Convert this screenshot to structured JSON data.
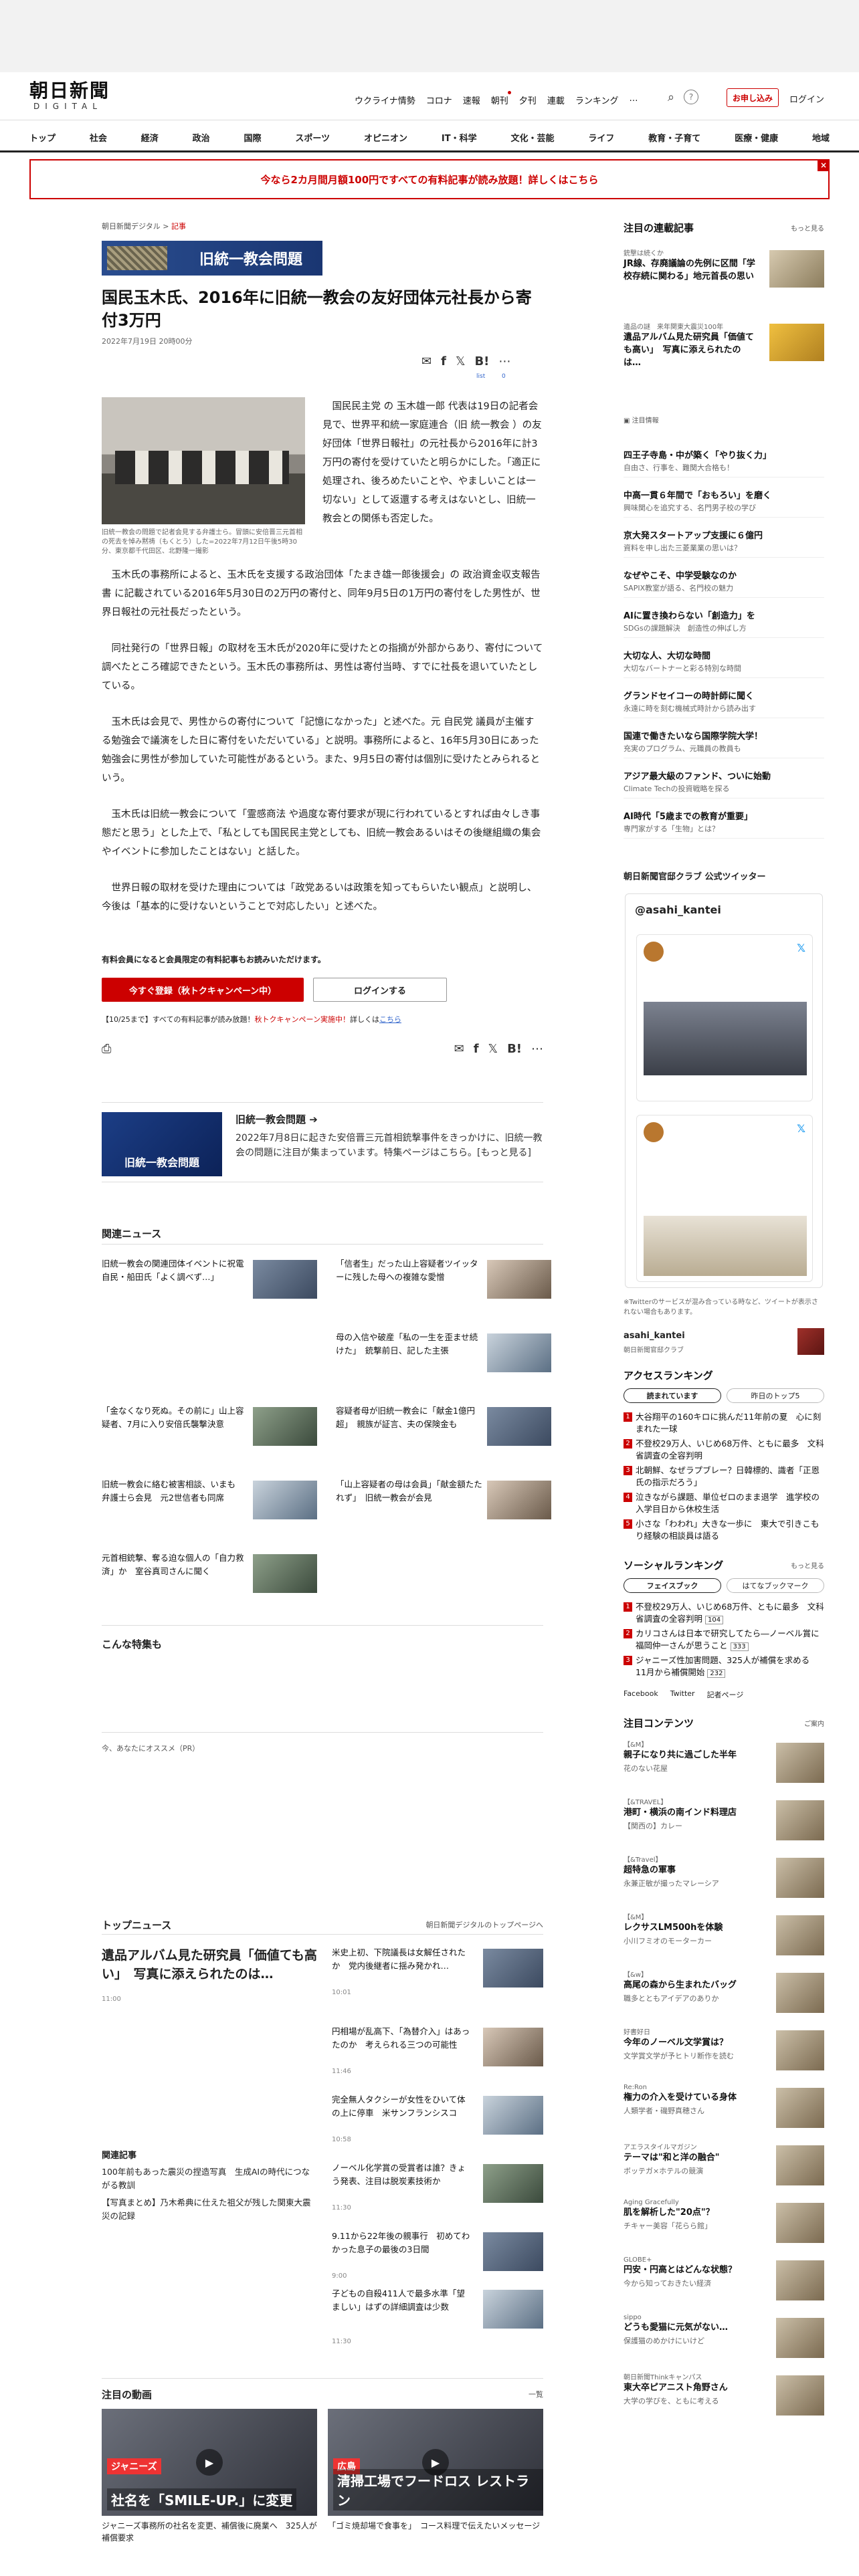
{
  "header": {
    "logo_title": "朝日新聞",
    "logo_sub": "DIGITAL",
    "nav": [
      "ウクライナ情勢",
      "コロナ",
      "速報",
      "朝刊",
      "夕刊",
      "連載",
      "ランキング",
      "…"
    ],
    "subscribe_label": "お申し込み",
    "login_label": "ログイン"
  },
  "global_nav": [
    "トップ",
    "社会",
    "経済",
    "政治",
    "国際",
    "スポーツ",
    "オピニオン",
    "IT・科学",
    "文化・芸能",
    "ライフ",
    "教育・子育て",
    "医療・健康",
    "地域"
  ],
  "banner": {
    "text": "今なら2カ月間月額100円ですべての有料記事が読み放題！詳しくはこちら",
    "close": "×"
  },
  "article": {
    "crumb_site": "朝日新聞デジタル",
    "crumb_sep": ">",
    "crumb_section": "記事",
    "tag_banner": "旧統一教会問題",
    "title": "国民玉木氏、2016年に旧統一教会の友好団体元社長から寄付3万円",
    "date": "2022年7月19日 20時00分",
    "share_list": "list",
    "share_count": "0",
    "photo_caption": "旧統一教会の問題で記者会見する弁護士ら。冒頭に安倍晋三元首相の死去を悼み黙祷（もくとう）した=2022年7月12日午後5時30分、東京都千代田区、北野隆一撮影",
    "lead": "国民民主党 の 玉木雄一郎 代表は19日の記者会見で、世界平和統一家庭連合（旧 統一教会 ）の友好団体「世界日報社」の元社長から2016年に計3万円の寄付を受けていたと明らかにした。「適正に処理され、後ろめたいことや、やましいことは一切ない」として返還する考えはないとし、旧統一教会との関係も否定した。",
    "paragraphs": [
      "玉木氏の事務所によると、玉木氏を支援する政治団体「たまき雄一郎後援会」の 政治資金収支報告書 に記載されている2016年5月30日の2万円の寄付と、同年9月5日の1万円の寄付をした男性が、世界日報社の元社長だったという。",
      "同社発行の「世界日報」の取材を玉木氏が2020年に受けたとの指摘が外部からあり、寄付について調べたところ確認できたという。玉木氏の事務所は、男性は寄付当時、すでに社長を退いていたとしている。",
      "玉木氏は会見で、男性からの寄付について「記憶になかった」と述べた。元 自民党 議員が主催する勉強会で議演をした日に寄付をいただいている」と説明。事務所によると、16年5月30日にあった勉強会に男性が参加していた可能性があるという。また、9月5日の寄付は個別に受けたとみられるという。",
      "玉木氏は旧統一教会について「霊感商法 や過度な寄付要求が現に行われているとすれば由々しき事態だと思う」とした上で、「私としても国民民主党としても、旧統一教会あるいはその後継組織の集会やイベントに参加したことはない」と話した。",
      "世界日報の取材を受けた理由については「政党あるいは政策を知ってもらいたい観点」と説明し、今後は「基本的に受けないということで対応したい」と述べた。"
    ],
    "member_note": "有料会員になると会員限定の有料記事もお読みいただけます。",
    "register_button": "今すぐ登録（秋トクキャンペーン中）",
    "login_button": "ログインする",
    "promo_prefix": "【10/25まで】すべての有料記事が読み放題！",
    "promo_highlight": "秋トクキャンペーン実施中！",
    "promo_suffix": "詳しくは",
    "promo_link": "こちら"
  },
  "feature": {
    "image_label": "旧統一教会問題",
    "heading": "旧統一教会問題 ➔",
    "desc": "2022年7月8日に起きた安倍晋三元首相銃撃事件をきっかけに、旧統一教会の問題に注目が集まっています。特集ページはこちら。[もっと見る]"
  },
  "related": {
    "heading": "関連ニュース",
    "items": [
      "旧統一教会の関連団体イベントに祝電　自民・船田氏「よく調べず…」",
      "「信者生」だった山上容疑者ツイッターに残した母への複雑な愛憎",
      "母の入信や破産「私の一生を歪ませ続けた」　銃撃前日、記した主張",
      "「金なくなり死ぬ。その前に」山上容疑者、7月に入り安倍氏襲撃決意",
      "容疑者母が旧統一教会に「献金1億円超」　親族が証言、夫の保険金も",
      "旧統一教会に絡む被害相談、いまも　弁護士ら会見　元2世信者も同席",
      "「山上容疑者の母は会員」「献金額たたれず」　旧統一教会が会見",
      "元首相銃撃、奪る迫な個人の「自力救済」か　室谷真司さんに聞く"
    ]
  },
  "special": {
    "heading": "こんな特集も"
  },
  "recommend": {
    "heading": "今、あなたにオススメ（PR）"
  },
  "top_news": {
    "heading": "トップニュース",
    "link": "朝日新聞デジタルのトップページへ",
    "main_title": "遺品アルバム見た研究員「価値ても高い」　写真に添えられたのは…",
    "main_time": "11:00",
    "related_heading": "関連記事",
    "related_items": [
      "100年前もあった震災の捏造写真　生成AIの時代につながる教訓",
      "【写真まとめ】乃木希典に仕えた祖父が残した関東大震災の記録"
    ],
    "items": [
      {
        "t": "米史上初、下院議長は女解任されたか　党内後継者に揺み発かれ…",
        "time": "10:01"
      },
      {
        "t": "円相場が乱高下、「為替介入」はあったのか　考えられる三つの可能性",
        "time": "11:46"
      },
      {
        "t": "完全無人タクシーが女性をひいて体の上に停車　米サンフランシスコ",
        "time": "10:58"
      },
      {
        "t": "ノーベル化学賞の受賞者は誰？きょう発表、注目は脱炭素技術か",
        "time": "11:30"
      },
      {
        "t": "9.11から22年後の親事行　初めてわかった息子の最後の3日間",
        "time": "9:00"
      },
      {
        "t": "子どもの自殺411人で最多水準「望ましい」はずの詳細調査は少数",
        "time": "11:30"
      }
    ]
  },
  "video": {
    "heading": "注目の動画",
    "link": "一覧",
    "items": [
      {
        "tag": "ジャニーズ",
        "label": "社名を「SMILE-UP.」に変更",
        "cap": "ジャニーズ事務所の社名を変更、補償後に廃業へ　325人が補償要求"
      },
      {
        "tag": "広島",
        "label": "清掃工場でフードロス レストラン",
        "cap": "「ゴミ焼却場で食事を」　コース料理で伝えたいメッセージ"
      }
    ]
  },
  "sidebar": {
    "series_heading": "注目の連載記事",
    "more": "もっと見る",
    "series": [
      {
        "cat": "銃撃は続くか",
        "t": "JR線、存廃議論の先例に区間「学校存続に関わる」地元首長の思い"
      },
      {
        "cat": "遺品の謎　来年関東大震災100年",
        "t": "遺品アルバム見た研究員「価値ても高い」　写真に添えられたのは…"
      }
    ],
    "kw_heading": "注目情報",
    "keywords": [
      {
        "a": "四王子寺島・中が築く「やり抜く力」",
        "b": "自由さ、行事を、難関大合格も！"
      },
      {
        "a": "中高一貫６年間で「おもろい」を磨く",
        "b": "興味関心を追究する、名門男子校の学び"
      },
      {
        "a": "京大発スタートアップ支援に６億円",
        "b": "資料を申し出た三菱業業の思いは？"
      },
      {
        "a": "なぜやこそ、中学受験なのか",
        "b": "SAPIX教室が語る、名門校の魅力"
      },
      {
        "a": "AIに置き換わらない「創造力」を",
        "b": "SDGsの課題解決　創造性の伸ばし方"
      },
      {
        "a": "大切な人、大切な時間",
        "b": "大切なバートナーと彩る特別な時間"
      },
      {
        "a": "グランドセイコーの時計師に聞く",
        "b": "永遠に時を刻む機械式時計から読み出す"
      },
      {
        "a": "国連で働きたいなら国際学院大学！",
        "b": "充実のプログラム、元職員の教員も"
      },
      {
        "a": "アジア最大級のファンド、ついに始動",
        "b": "Climate Techの投資戦略を探る"
      },
      {
        "a": "AI時代「5歳までの教育が重要」",
        "b": "専門家がする「生物」とは？"
      }
    ],
    "twitter_heading": "朝日新聞官邸クラブ 公式ツイッター",
    "tw_handle": "@asahi_kantei",
    "tw_note": "※Twitterのサービスが混み合っている時など、ツイートが表示されない場合もあります。",
    "tw_account": "asahi_kantei",
    "tw_account_sub": "朝日新聞官邸クラブ",
    "access_heading": "アクセスランキング",
    "access_tabs": [
      "読まれています",
      "昨日のトップ5"
    ],
    "access": [
      "大谷翔平の160キロに挑んだ11年前の夏　心に刻まれた一球",
      "不登校29万人、いじめ68万件、ともに最多　文科省調査の全容判明",
      "北朝鮮、なぜラプブレー？日韓標的、識者「正恩氏の指示だろう」",
      "泣きながら課題、単位ゼロのまま退学　進学校の入学目日から休校生活",
      "小さな「わわれ」大きな一歩に　東大で引きこもり経験の相談員は語る"
    ],
    "social_heading": "ソーシャルランキング",
    "social_tabs": [
      "フェイスブック",
      "はてなブックマーク"
    ],
    "social": [
      {
        "t": "不登校29万人、いじめ68万件、ともに最多　文科省調査の全容判明",
        "c": "104"
      },
      {
        "t": "カリコさんは日本で研究してたら―ノーベル賞に福岡仲一さんが思うこと",
        "c": "333"
      },
      {
        "t": "ジャニーズ性加害問題、325人が補償を求める　11月から補償開始",
        "c": "232"
      }
    ],
    "follow": [
      "Facebook",
      "Twitter",
      "記者ページ"
    ],
    "contents_heading": "注目コンテンツ",
    "contents_link": "ご案内",
    "contents": [
      {
        "c": "【&M】",
        "a": "親子になり共に過ごした半年",
        "b": "花のない花屋"
      },
      {
        "c": "【&TRAVEL】",
        "a": "港町・横浜の南インド料理店",
        "b": "【関西の】カレー"
      },
      {
        "c": "【&Travel】",
        "a": "超特急の軍事",
        "b": "永兼正敏が撮ったマレーシア"
      },
      {
        "c": "【&M】",
        "a": "レクサスLM500hを体験",
        "b": "小川フミオのモーターカー"
      },
      {
        "c": "【&w】",
        "a": "高尾の森から生まれたバッグ",
        "b": "職多とともアイデアのありか"
      },
      {
        "c": "好書好日",
        "a": "今年のノーベル文学賞は？",
        "b": "文学賞文学が予ヒトリ断作を読む"
      },
      {
        "c": "Re:Ron",
        "a": "権力の介入を受けている身体",
        "b": "人類学者・磯野真穂さん"
      },
      {
        "c": "アエラスタイルマガジン",
        "a": "テーマは\"和と洋の融合\"",
        "b": "ボッテガ×ホテルの競演"
      },
      {
        "c": "Aging Gracefully",
        "a": "肌を解析した\"20点\"？",
        "b": "チキャー美容「花らら館」"
      },
      {
        "c": "GLOBE+",
        "a": "円安・円高とはどんな状態？",
        "b": "今から知っておきたい経済"
      },
      {
        "c": "sippo",
        "a": "どうも愛猫に元気がない…",
        "b": "保護猫のめかけにいけど"
      },
      {
        "c": "朝日新聞Thinkキャンパス",
        "a": "東大卒ピアニスト角野さん",
        "b": "大学の学びを、ともに考える"
      }
    ]
  },
  "colors": {
    "accent": "#cc0000",
    "navy": "#1a3672"
  }
}
